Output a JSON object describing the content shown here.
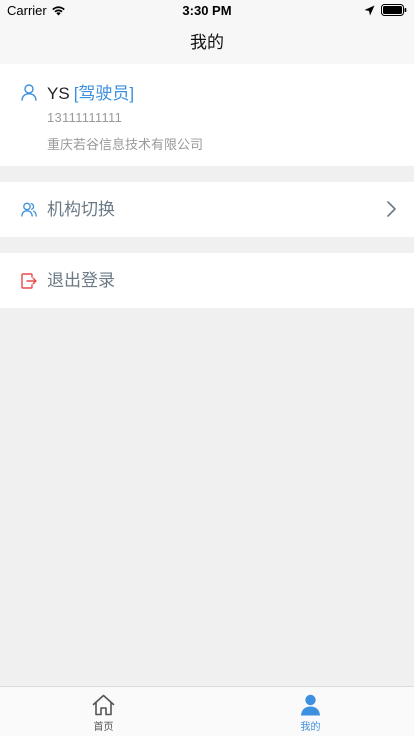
{
  "status_bar": {
    "carrier": "Carrier",
    "time": "3:30 PM"
  },
  "nav": {
    "title": "我的"
  },
  "profile": {
    "name": "YS",
    "role": "[驾驶员]",
    "phone": "13111111111",
    "company": "重庆若谷信息技术有限公司"
  },
  "menu": {
    "switch_org": "机构切换",
    "logout": "退出登录"
  },
  "tabs": [
    {
      "label": "首页",
      "icon": "home-icon",
      "active": false
    },
    {
      "label": "我的",
      "icon": "person-icon",
      "active": true
    }
  ],
  "colors": {
    "accent": "#3d8fe0",
    "logout_icon": "#e84a4a",
    "background": "#f0f0f0"
  }
}
